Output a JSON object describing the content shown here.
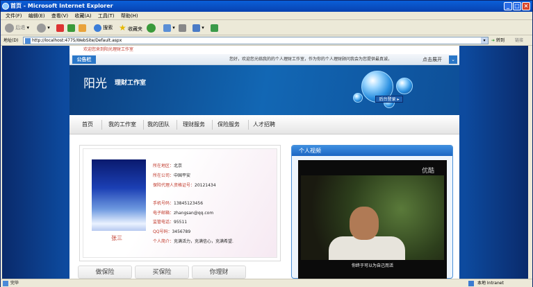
{
  "window": {
    "title": "首页 - Microsoft Internet Explorer"
  },
  "menu": [
    "文件(F)",
    "编辑(E)",
    "查看(V)",
    "收藏(A)",
    "工具(T)",
    "帮助(H)"
  ],
  "toolbar": {
    "back": "后退",
    "search": "搜索",
    "favorites": "收藏夹"
  },
  "address": {
    "label": "地址(D)",
    "url": "http://localhost:4775/WebSite/Default.aspx",
    "go": "转到",
    "links": "链接"
  },
  "status": {
    "left": "完毕",
    "zone": "本地 Intranet"
  },
  "page": {
    "welcome": "欢迎您来到阳光理财工作室",
    "notice_tag": "公告栏",
    "notice_text": "您好，欢迎您光临我的的个人理财工作室，作为你的个人理财顾问我会为您提供最真诚，",
    "expand": "点击展开",
    "brand": "阳光",
    "brand_sub": "理财工作室",
    "login": "后台登录",
    "nav": [
      "首页",
      "我的工作室",
      "我的团队",
      "理财服务",
      "保险服务",
      "人才招聘"
    ],
    "profile": {
      "name": "张三",
      "fields": [
        {
          "k": "所在地区：",
          "v": "北京"
        },
        {
          "k": "所在公司：",
          "v": "中国平安"
        },
        {
          "k": "保险代理人资格证号：",
          "v": "20121434"
        },
        {
          "k": "手机号码：",
          "v": "13845123456"
        },
        {
          "k": "电子邮箱：",
          "v": "zhangsan@qq.com"
        },
        {
          "k": "监管电话：",
          "v": "95511"
        },
        {
          "k": "QQ号码：",
          "v": "3456789"
        },
        {
          "k": "个人简介：",
          "v": "充满活力，充满信心，充满希望."
        }
      ]
    },
    "video": {
      "title": "个人视频",
      "logo": "优酷",
      "subtitle": "你终于可以为自己而活"
    },
    "ads": [
      "做保险",
      "买保险",
      "你理财"
    ]
  }
}
